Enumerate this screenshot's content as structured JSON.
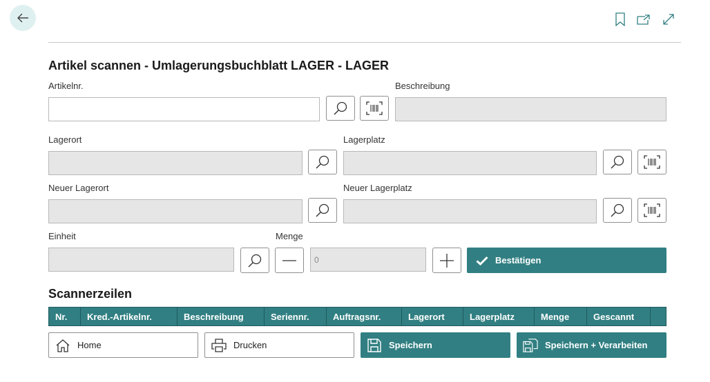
{
  "page": {
    "title": "Artikel scannen - Umlagerungsbuchblatt LAGER - LAGER",
    "icons": {
      "back": "arrow-left-icon",
      "bookmark": "bookmark-icon",
      "open_new": "open-in-new-window-icon",
      "expand": "expand-icon"
    }
  },
  "form": {
    "artikelnr": {
      "label": "Artikelnr.",
      "value": ""
    },
    "beschreibung": {
      "label": "Beschreibung",
      "value": ""
    },
    "lagerort": {
      "label": "Lagerort",
      "value": ""
    },
    "lagerplatz": {
      "label": "Lagerplatz",
      "value": ""
    },
    "neuer_lagerort": {
      "label": "Neuer Lagerort",
      "value": ""
    },
    "neuer_lagerplatz": {
      "label": "Neuer Lagerplatz",
      "value": ""
    },
    "einheit": {
      "label": "Einheit",
      "value": ""
    },
    "menge": {
      "label": "Menge",
      "value": "0"
    },
    "confirm_label": "Bestätigen"
  },
  "scanner": {
    "title": "Scannerzeilen",
    "columns": [
      "Nr.",
      "Kred.-Artikelnr.",
      "Beschreibung",
      "Seriennr.",
      "Auftragsnr.",
      "Lagerort",
      "Lagerplatz",
      "Menge",
      "Gescannt"
    ]
  },
  "actions": {
    "home": "Home",
    "print": "Drucken",
    "save": "Speichern",
    "save_process": "Speichern + Verarbeiten"
  },
  "colors": {
    "accent": "#317f82",
    "readonly_field": "#e6e6e6",
    "back_button_bg": "#dff0f0"
  }
}
